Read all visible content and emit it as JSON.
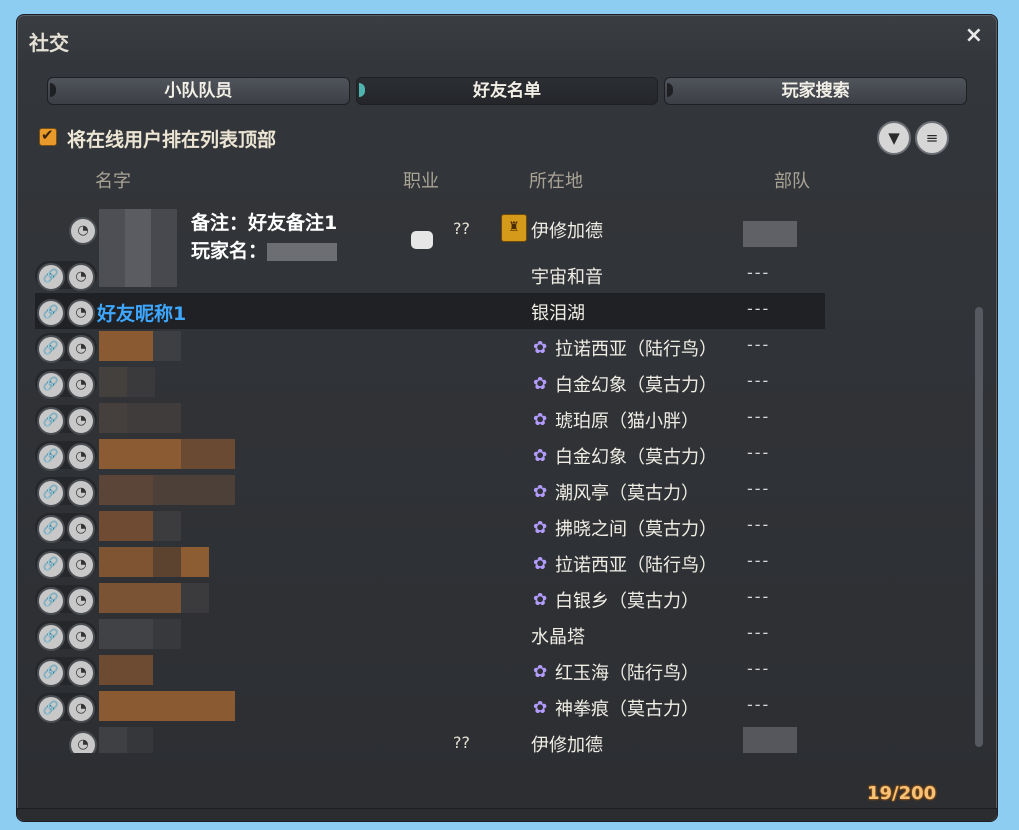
{
  "window": {
    "title": "社交",
    "close_glyph": "×"
  },
  "tabs": [
    {
      "label": "小队队员",
      "active": false
    },
    {
      "label": "好友名单",
      "active": true
    },
    {
      "label": "玩家搜索",
      "active": false
    }
  ],
  "options": {
    "sort_online_top_label": "将在线用户排在列表顶部",
    "sort_online_top_checked": true
  },
  "toolbar": {
    "filter_icon": "filter-icon",
    "sort_icon": "sort-icon"
  },
  "columns": {
    "name": "名字",
    "job": "职业",
    "location": "所在地",
    "unit": "部队"
  },
  "tooltip": {
    "note": "备注：好友备注1",
    "player_name_label": "玩家名："
  },
  "rows": [
    {
      "name": "",
      "job": "??",
      "location": "伊修加德",
      "dc_icon": false,
      "unit": ""
    },
    {
      "name": "",
      "job": "",
      "location": "宇宙和音",
      "dc_icon": false,
      "unit": "---"
    },
    {
      "name": "好友昵称1",
      "job": "",
      "location": "银泪湖",
      "dc_icon": false,
      "unit": "---"
    },
    {
      "name": "",
      "job": "",
      "location": "拉诺西亚（陆行鸟）",
      "dc_icon": true,
      "unit": "---"
    },
    {
      "name": "",
      "job": "",
      "location": "白金幻象（莫古力）",
      "dc_icon": true,
      "unit": "---"
    },
    {
      "name": "",
      "job": "",
      "location": "琥珀原（猫小胖）",
      "dc_icon": true,
      "unit": "---"
    },
    {
      "name": "",
      "job": "",
      "location": "白金幻象（莫古力）",
      "dc_icon": true,
      "unit": "---"
    },
    {
      "name": "",
      "job": "",
      "location": "潮风亭（莫古力）",
      "dc_icon": true,
      "unit": "---"
    },
    {
      "name": "",
      "job": "",
      "location": "拂晓之间（莫古力）",
      "dc_icon": true,
      "unit": "---"
    },
    {
      "name": "",
      "job": "",
      "location": "拉诺西亚（陆行鸟）",
      "dc_icon": true,
      "unit": "---"
    },
    {
      "name": "",
      "job": "",
      "location": "白银乡（莫古力）",
      "dc_icon": true,
      "unit": "---"
    },
    {
      "name": "",
      "job": "",
      "location": "水晶塔",
      "dc_icon": false,
      "unit": "---"
    },
    {
      "name": "",
      "job": "",
      "location": "红玉海（陆行鸟）",
      "dc_icon": true,
      "unit": "---"
    },
    {
      "name": "",
      "job": "",
      "location": "神拳痕（莫古力）",
      "dc_icon": true,
      "unit": "---"
    },
    {
      "name": "",
      "job": "??",
      "location": "伊修加德",
      "dc_icon": false,
      "unit": ""
    }
  ],
  "footer": {
    "count": "19/200"
  },
  "colors": {
    "accent_teal": "#4fb3b0",
    "name_blue": "#3ea7ff",
    "checkbox_orange": "#e89a2a",
    "count_orange": "#f6c27a"
  }
}
